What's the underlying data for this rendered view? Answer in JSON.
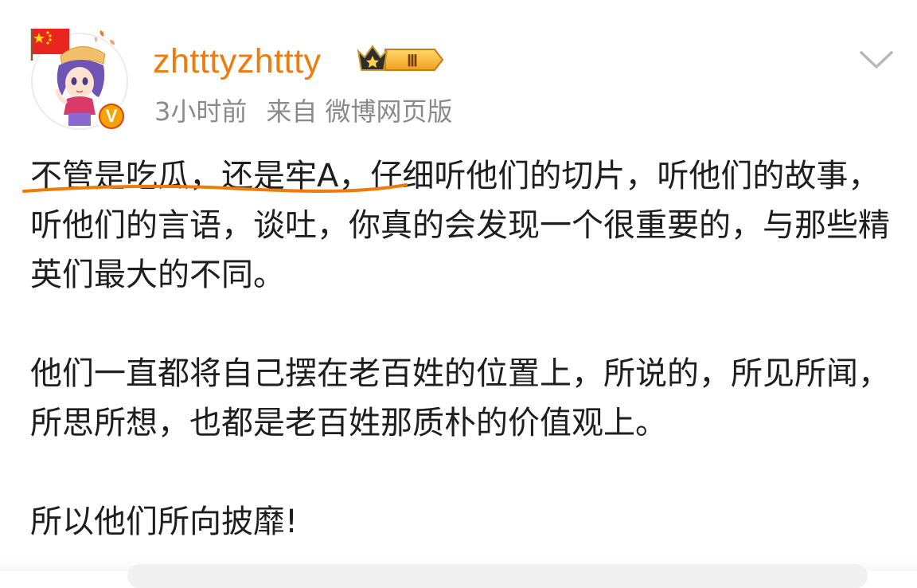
{
  "author": {
    "username": "zhtttyzhttty",
    "vip_level": "Ⅲ",
    "verified_mark": "V"
  },
  "meta": {
    "time": "3小时前",
    "source": "来自 微博网页版"
  },
  "post": {
    "paragraphs": [
      "不管是吃瓜，还是牢A，仔细听他们的切片，听他们的故事，听他们的言语，谈吐，你真的会发现一个很重要的，与那些精英们最大的不同。",
      "他们一直都将自己摆在老百姓的位置上，所说的，所见所闻，所思所想，也都是老百姓那质朴的价值观上。",
      "所以他们所向披靡!"
    ]
  },
  "icons": {
    "flag": "china-flag-icon",
    "vip": "crown-vip-badge-icon",
    "verified": "verified-v-icon",
    "more": "chevron-down-icon"
  },
  "colors": {
    "username": "#f07a0a",
    "meta": "#8a8a8a",
    "body_text": "#1e1e1e",
    "underline": "#f07a0a",
    "verified_bg": "#f5a300"
  }
}
